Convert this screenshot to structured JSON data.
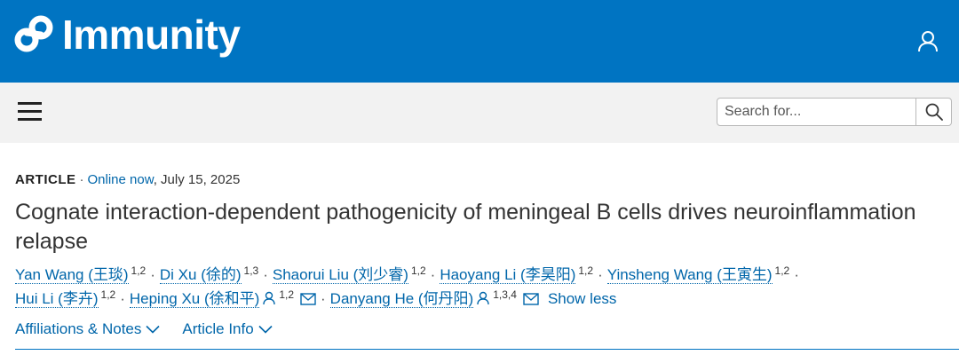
{
  "header": {
    "brand": "Immunity",
    "logo_icon": "cell-press-logo-icon",
    "user_icon": "user-icon",
    "brand_color": "#0074c2"
  },
  "toolbar": {
    "menu_icon": "hamburger-menu-icon",
    "search_placeholder": "Search for...",
    "search_icon": "search-icon"
  },
  "article": {
    "type": "ARTICLE",
    "status": "Online now",
    "date": ", July 15, 2025",
    "title": "Cognate interaction-dependent pathogenicity of meningeal B cells drives neuroinflammation relapse"
  },
  "authors": [
    {
      "name": "Yan Wang (王琰)",
      "aff": "1,2"
    },
    {
      "name": "Di Xu (徐的)",
      "aff": "1,3"
    },
    {
      "name": "Shaorui Liu (刘少睿)",
      "aff": "1,2"
    },
    {
      "name": "Haoyang Li (李昊阳)",
      "aff": "1,2"
    },
    {
      "name": "Yinsheng Wang (王寅生)",
      "aff": "1,2"
    },
    {
      "name": "Hui Li (李卉)",
      "aff": "1,2"
    },
    {
      "name": "Heping Xu (徐和平)",
      "aff": "1,2"
    },
    {
      "name": "Danyang He (何丹阳)",
      "aff": "1,3,4"
    }
  ],
  "separator": "·",
  "show_less": "Show less",
  "tabs": [
    {
      "label": "Affiliations & Notes"
    },
    {
      "label": "Article Info"
    }
  ]
}
